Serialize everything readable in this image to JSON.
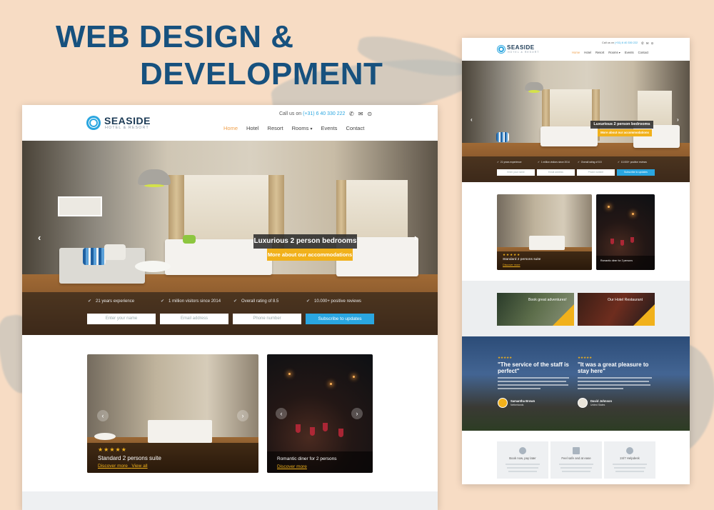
{
  "headline": {
    "line1": "WEB DESIGN &",
    "line2": "DEVELOPMENT"
  },
  "brand": {
    "name": "SEASIDE",
    "tagline": "HOTEL & RESORT"
  },
  "contact": {
    "label": "Call us on",
    "phone": "(+31) 6 40 330 222"
  },
  "nav": [
    "Home",
    "Hotel",
    "Resort",
    "Rooms",
    "Events",
    "Contact"
  ],
  "nav_active": "Home",
  "hero": {
    "title": "Luxurious 2 person bedrooms",
    "button": "More about our accommodations",
    "features": [
      "21 years experience",
      "1 million visitors since 2014",
      "Overall rating of 8.5",
      "10.000+ positive reviews"
    ],
    "form": {
      "name_placeholder": "Enter your name",
      "email_placeholder": "Email address",
      "phone_placeholder": "Phone number",
      "submit": "Subscribe to updates"
    }
  },
  "cards": [
    {
      "title": "Standard 2 persons suite",
      "rating": "★★★★★",
      "link1": "Discover more",
      "link2": "View all"
    },
    {
      "title": "Romantic diner for 2 persons",
      "link1": "Discover more"
    }
  ],
  "small_cards": [
    {
      "title": "Standard 2 persons suite",
      "rating": "★★★★★",
      "link1": "Discover more"
    },
    {
      "title": "Romantic diner for 2 persons"
    }
  ],
  "advertising": [
    {
      "title": "Book great adventures!"
    },
    {
      "title": "Our Hotel Restaurant"
    }
  ],
  "testimonials": [
    {
      "rating": "★★★★★",
      "quote": "\"The service of the staff is perfect\"",
      "name": "Samantha Brown",
      "location": "Netherlands"
    },
    {
      "rating": "★★★★★",
      "quote": "\"It was a great pleasure to stay here\"",
      "name": "David Johnson",
      "location": "United States"
    }
  ],
  "services": [
    "Book now, pay later",
    "Feel safe and at ease",
    "24/7 Helpdesk"
  ],
  "icons": [
    "phone-icon",
    "mail-icon",
    "location-icon",
    "chevron-down-icon",
    "check-icon",
    "arrow-left-icon",
    "arrow-right-icon"
  ],
  "colors": {
    "brand_blue": "#2aa6e0",
    "accent_yellow": "#f1b11b",
    "nav_active": "#f0a04b",
    "headline_blue": "#17517e",
    "background": "#f7dcc4"
  }
}
